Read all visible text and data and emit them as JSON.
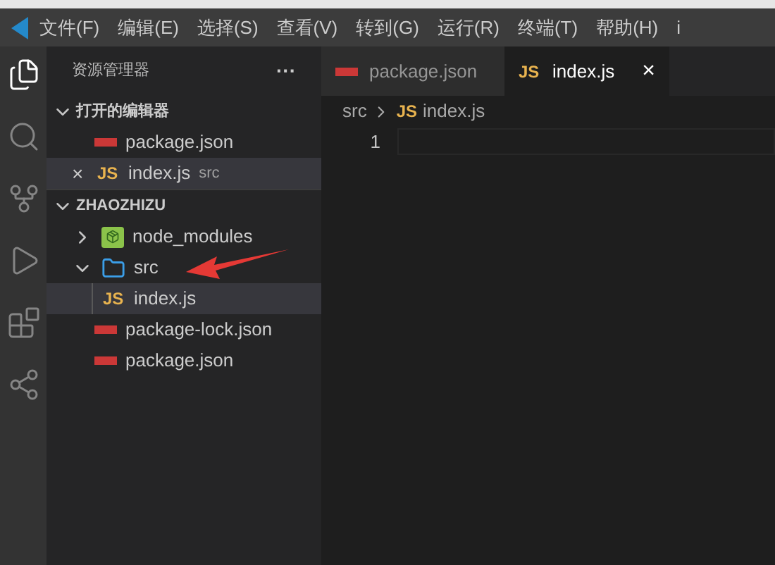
{
  "menu_bar": {
    "items": [
      "文件(F)",
      "编辑(E)",
      "选择(S)",
      "查看(V)",
      "转到(G)",
      "运行(R)",
      "终端(T)",
      "帮助(H)",
      "i"
    ]
  },
  "activity_bar": {
    "items": [
      {
        "kind": "files",
        "selected": true
      },
      {
        "kind": "search",
        "selected": false
      },
      {
        "kind": "source",
        "selected": false
      },
      {
        "kind": "run",
        "selected": false
      },
      {
        "kind": "extensions",
        "selected": false
      },
      {
        "kind": "remote",
        "selected": false
      }
    ]
  },
  "sidebar": {
    "title": "资源管理器",
    "more": "···",
    "sections": [
      {
        "title": "打开的编辑器",
        "expanded": true,
        "items": [
          {
            "name": "package.json",
            "kind": "npm",
            "selected": false
          },
          {
            "name": "index.js",
            "kind": "js",
            "badge": "JS",
            "close": "×",
            "detail": "src",
            "selected": true
          }
        ]
      },
      {
        "title": "ZHAOZHIZU",
        "expanded": true,
        "items": [
          {
            "name": "node_modules",
            "kind": "node",
            "expanded": false,
            "selected": false
          },
          {
            "name": "src",
            "kind": "folder",
            "expanded": true,
            "selected": false,
            "children": [
              {
                "name": "index.js",
                "kind": "js",
                "badge": "JS",
                "selected": true
              }
            ]
          },
          {
            "name": "package-lock.json",
            "kind": "npm",
            "selected": false
          },
          {
            "name": "package.json",
            "kind": "npm",
            "selected": false
          }
        ]
      }
    ]
  },
  "tabs": [
    {
      "label": "package.json",
      "kind": "npm",
      "selected": false
    },
    {
      "label": "index.js",
      "kind": "js",
      "badge": "JS",
      "close": "×",
      "selected": true
    }
  ],
  "breadcrumb": {
    "folder": "src",
    "badge": "JS",
    "file": "index.js"
  },
  "editor": {
    "lines": [
      "1"
    ]
  }
}
